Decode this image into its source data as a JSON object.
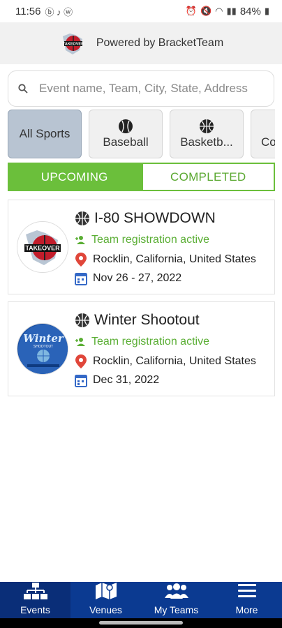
{
  "status_bar": {
    "time": "11:56",
    "battery": "84%"
  },
  "header": {
    "powered_by": "Powered by BracketTeam"
  },
  "search": {
    "placeholder": "Event name, Team, City, State, Address"
  },
  "sports": [
    {
      "label": "All Sports",
      "icon": "none",
      "active": true
    },
    {
      "label": "Baseball",
      "icon": "baseball-icon",
      "active": false
    },
    {
      "label": "Basketb...",
      "icon": "basketball-icon",
      "active": false
    },
    {
      "label": "Co",
      "icon": "unknown",
      "active": false
    }
  ],
  "tabs": {
    "upcoming": "UPCOMING",
    "completed": "COMPLETED"
  },
  "events": [
    {
      "title": "I-80 SHOWDOWN",
      "registration": "Team registration active",
      "location": "Rocklin, California, United States",
      "dates": "Nov 26 - 27, 2022"
    },
    {
      "title": "Winter Shootout",
      "registration": "Team registration active",
      "location": "Rocklin, California, United States",
      "dates": "Dec 31, 2022"
    }
  ],
  "nav": {
    "events": "Events",
    "venues": "Venues",
    "my_teams": "My Teams",
    "more": "More"
  },
  "colors": {
    "accent_green": "#6bbf3b",
    "nav_blue": "#0b3a91",
    "location_red": "#e0463a",
    "calendar_blue": "#3569c7"
  }
}
